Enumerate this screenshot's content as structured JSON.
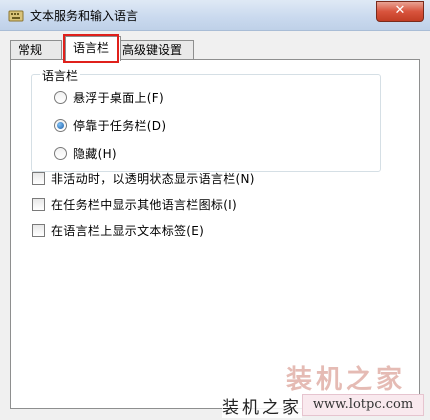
{
  "window": {
    "title": "文本服务和输入语言",
    "close_label": "✕"
  },
  "tabs": [
    {
      "label": "常规"
    },
    {
      "label": "语言栏"
    },
    {
      "label": "高级键设置"
    }
  ],
  "highlight_color": "#e0201b",
  "language_bar_group": {
    "label": "语言栏",
    "options": [
      {
        "label": "悬浮于桌面上(F)",
        "checked": false
      },
      {
        "label": "停靠于任务栏(D)",
        "checked": true
      },
      {
        "label": "隐藏(H)",
        "checked": false
      }
    ]
  },
  "checkboxes": [
    {
      "label": "非活动时，以透明状态显示语言栏(N)",
      "checked": false
    },
    {
      "label": "在任务栏中显示其他语言栏图标(I)",
      "checked": false
    },
    {
      "label": "在语言栏上显示文本标签(E)",
      "checked": false
    }
  ],
  "watermark": {
    "logo": "装机之家",
    "text": "装机之家",
    "url": "www.lotpc.com"
  }
}
